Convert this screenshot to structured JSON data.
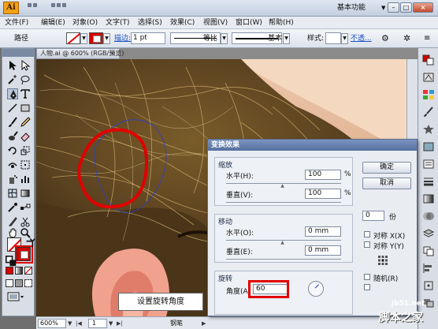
{
  "titlebar": {
    "app_logo": "Ai",
    "workspace": "基本功能"
  },
  "menu": [
    "文件(F)",
    "编辑(E)",
    "对象(O)",
    "文字(T)",
    "选择(S)",
    "效果(C)",
    "视图(V)",
    "窗口(W)",
    "帮助(H)"
  ],
  "control_bar": {
    "object_type": "路径",
    "stroke_label": "描边:",
    "stroke_weight": "1 pt",
    "profile_label": "等比",
    "brush_label": "基本",
    "style_label": "样式:",
    "opacity_link": "不透..."
  },
  "document": {
    "tab_title": "人物.ai @ 600% (RGB/预览)",
    "tab_close": "×",
    "zoom": "600%",
    "page": "1",
    "status_tool": "钢笔"
  },
  "dialog": {
    "title": "变换效果",
    "scale": {
      "label": "缩放",
      "horizontal_label": "水平(H):",
      "horizontal_value": "100",
      "vertical_label": "垂直(V):",
      "vertical_value": "100",
      "unit": "%"
    },
    "move": {
      "label": "移动",
      "horizontal_label": "水平(O):",
      "horizontal_value": "0 mm",
      "vertical_label": "垂直(E):",
      "vertical_value": "0 mm"
    },
    "rotate": {
      "label": "旋转",
      "angle_label": "角度(A)",
      "angle_value": "60"
    },
    "ok_label": "确定",
    "cancel_label": "取消",
    "copies_value": "0",
    "copies_unit": "份",
    "reflect_x": "对称 X(X)",
    "reflect_y": "对称 Y(Y)",
    "random": "随机(R)"
  },
  "caption": "设置旋转角度",
  "watermark": {
    "site": "jb51.net",
    "brand": "脚本之家"
  },
  "colors": {
    "highlight": "#e00000",
    "hair_path": "#e00000"
  }
}
